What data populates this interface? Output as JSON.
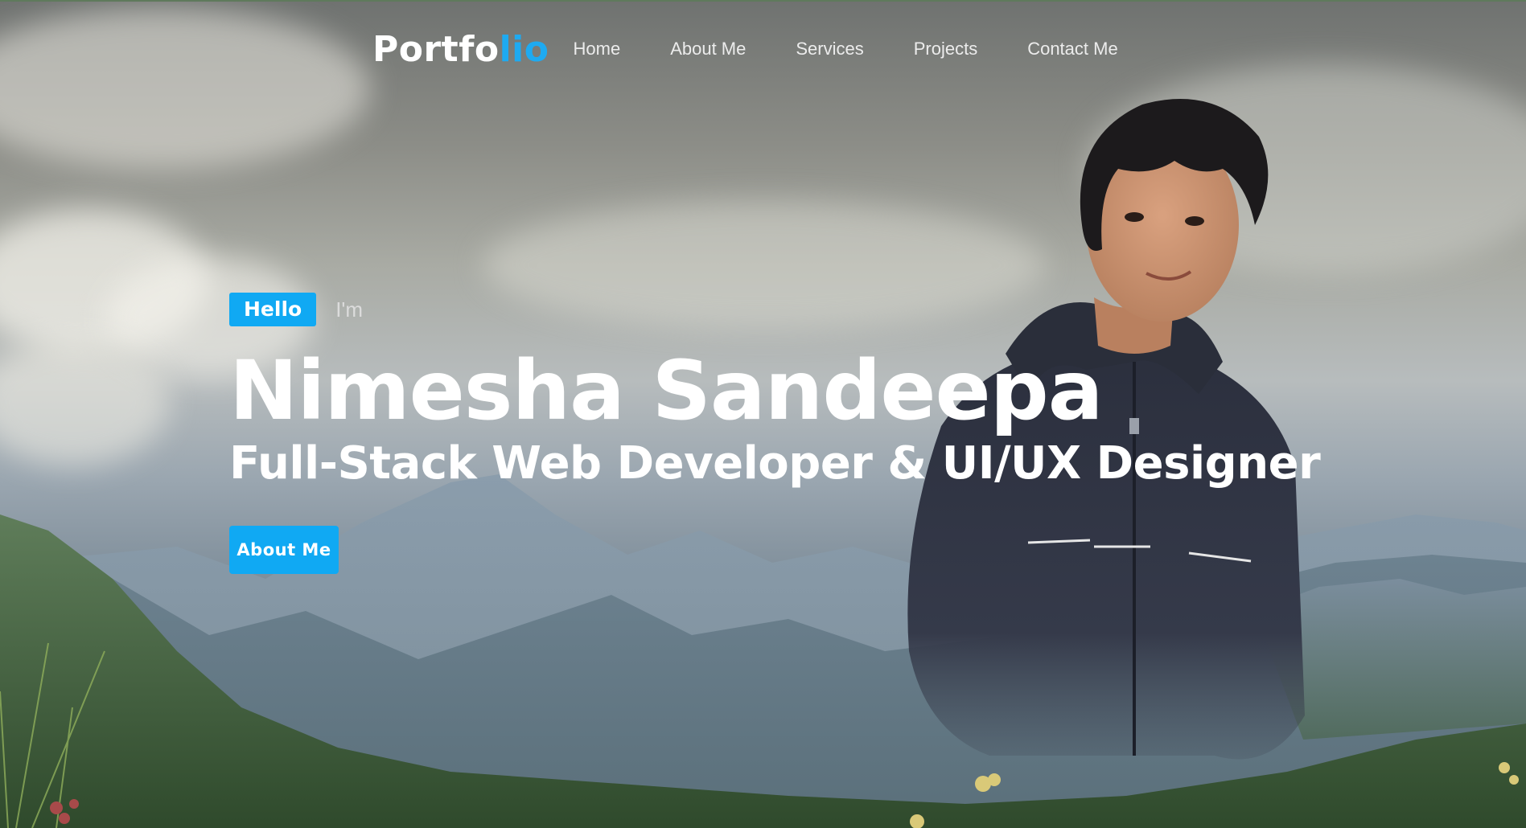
{
  "nav": {
    "logo_main": "Portfo",
    "logo_accent": "lio",
    "links": [
      {
        "label": "Home"
      },
      {
        "label": "About Me"
      },
      {
        "label": "Services"
      },
      {
        "label": "Projects"
      },
      {
        "label": "Contact Me"
      }
    ]
  },
  "hero": {
    "greeting_badge": "Hello",
    "greeting_suffix": "I'm",
    "name": "Nimesha Sandeepa",
    "role": "Full-Stack Web Developer & UI/UX Designer",
    "cta_label": "About Me"
  },
  "colors": {
    "accent": "#10a9f3",
    "text": "#ffffff"
  }
}
